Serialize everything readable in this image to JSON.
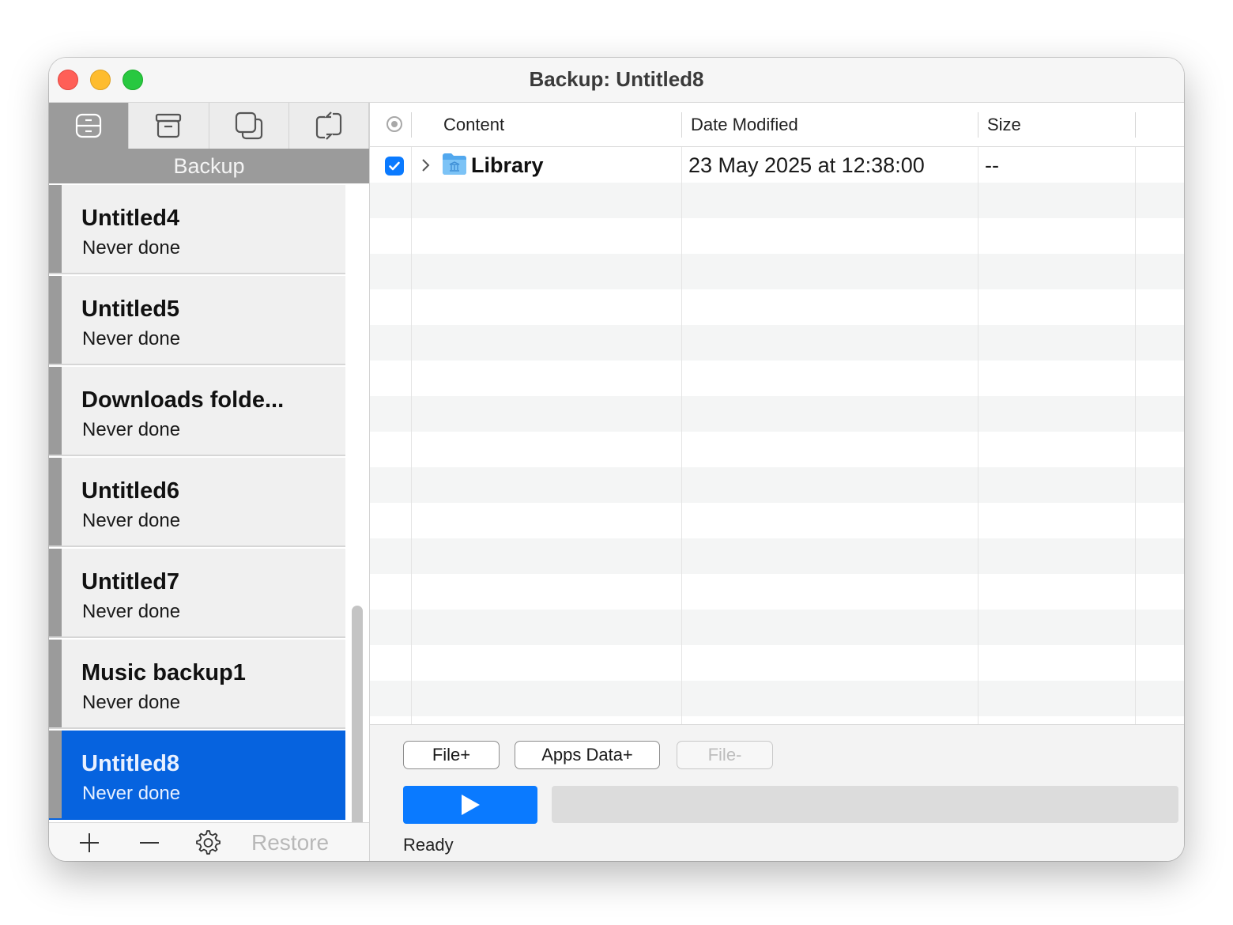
{
  "window": {
    "title": "Backup: Untitled8"
  },
  "sidebar": {
    "tabs": [
      {
        "icon": "backup-drive-icon",
        "active": true
      },
      {
        "icon": "archive-box-icon",
        "active": false
      },
      {
        "icon": "copy-squares-icon",
        "active": false
      },
      {
        "icon": "sync-arrows-icon",
        "active": false
      }
    ],
    "mode_label": "Backup",
    "items": [
      {
        "name": "Untitled4",
        "status": "Never done"
      },
      {
        "name": "Untitled5",
        "status": "Never done"
      },
      {
        "name": "Downloads folde...",
        "status": "Never done"
      },
      {
        "name": "Untitled6",
        "status": "Never done"
      },
      {
        "name": "Untitled7",
        "status": "Never done"
      },
      {
        "name": "Music backup1",
        "status": "Never done"
      },
      {
        "name": "Untitled8",
        "status": "Never done",
        "selected": true
      }
    ],
    "footer": {
      "add_icon": "plus-icon",
      "remove_icon": "minus-icon",
      "settings_icon": "gear-icon",
      "restore_label": "Restore"
    }
  },
  "table": {
    "columns": {
      "content": "Content",
      "date_modified": "Date Modified",
      "size": "Size"
    },
    "rows": [
      {
        "checked": true,
        "name": "Library",
        "date_modified": "23 May 2025 at 12:38:00",
        "size": "--",
        "icon": "library-folder-icon"
      }
    ]
  },
  "actions": {
    "file_plus": "File+",
    "apps_data_plus": "Apps Data+",
    "file_minus": "File-",
    "progress": 0,
    "status": "Ready"
  },
  "colors": {
    "accent": "#0a7aff",
    "selection": "#0663df",
    "sidebar_bar": "#9b9b9b"
  }
}
